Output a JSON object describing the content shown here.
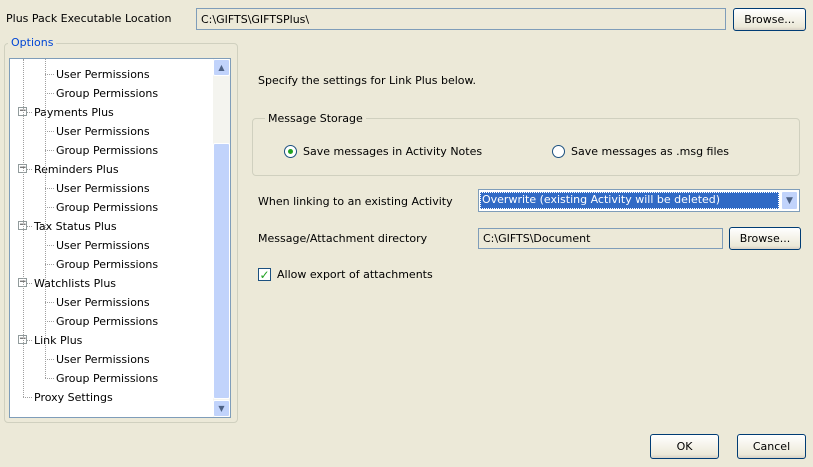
{
  "exe_location": {
    "label": "Plus Pack Executable Location",
    "value": "C:\\GIFTS\\GIFTSPlus\\",
    "browse_label": "Browse..."
  },
  "options_group": {
    "title": "Options"
  },
  "tree": {
    "items": [
      {
        "label": "User Permissions",
        "level": 1
      },
      {
        "label": "Group Permissions",
        "level": 1
      },
      {
        "label": "Payments Plus",
        "level": 0,
        "expander": "−"
      },
      {
        "label": "User Permissions",
        "level": 1
      },
      {
        "label": "Group Permissions",
        "level": 1
      },
      {
        "label": "Reminders Plus",
        "level": 0,
        "expander": "−"
      },
      {
        "label": "User Permissions",
        "level": 1
      },
      {
        "label": "Group Permissions",
        "level": 1
      },
      {
        "label": "Tax Status Plus",
        "level": 0,
        "expander": "−"
      },
      {
        "label": "User Permissions",
        "level": 1
      },
      {
        "label": "Group Permissions",
        "level": 1
      },
      {
        "label": "Watchlists Plus",
        "level": 0,
        "expander": "−"
      },
      {
        "label": "User Permissions",
        "level": 1
      },
      {
        "label": "Group Permissions",
        "level": 1
      },
      {
        "label": "Link Plus",
        "level": 0,
        "expander": "−"
      },
      {
        "label": "User Permissions",
        "level": 1
      },
      {
        "label": "Group Permissions",
        "level": 1
      },
      {
        "label": "Proxy Settings",
        "level": 0
      }
    ],
    "scroll_up_icon": "chevron-up-icon",
    "scroll_down_icon": "chevron-down-icon"
  },
  "settings": {
    "intro": "Specify the settings for Link Plus below.",
    "message_storage": {
      "title": "Message Storage",
      "option_notes": "Save messages in Activity Notes",
      "option_msg": "Save messages as .msg files",
      "selected": "option_notes"
    },
    "existing_activity": {
      "label": "When linking to an existing Activity",
      "value": "Overwrite (existing Activity will be deleted)"
    },
    "attachment_dir": {
      "label": "Message/Attachment directory",
      "value": "C:\\GIFTS\\Document",
      "browse_label": "Browse..."
    },
    "allow_export": {
      "label": "Allow export of attachments",
      "checked": true
    }
  },
  "footer": {
    "ok_label": "OK",
    "cancel_label": "Cancel"
  }
}
